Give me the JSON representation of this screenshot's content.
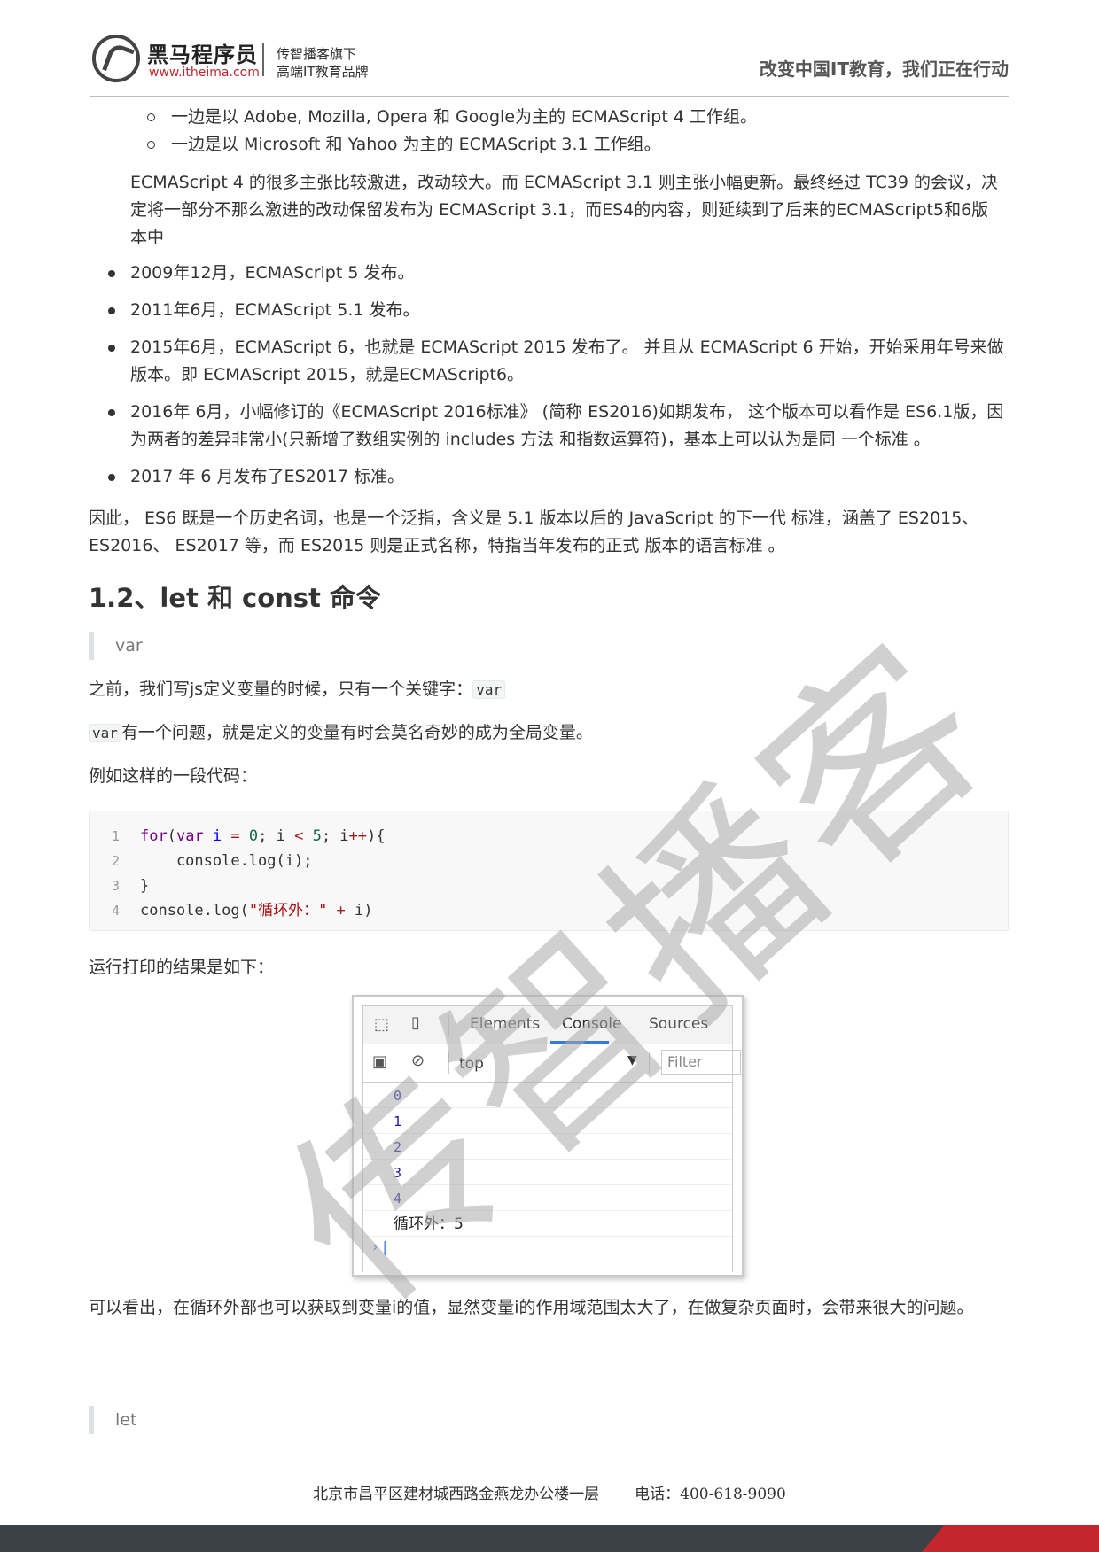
{
  "header": {
    "logo_name": "黑马程序员",
    "logo_url": "www.itheima.com",
    "logo_tag1": "传智播客旗下",
    "logo_tag2": "高端IT教育品牌",
    "slogan": "改变中国IT教育，我们正在行动"
  },
  "sub_list": [
    "一边是以 Adobe, Mozilla, Opera 和 Google为主的 ECMAScript 4 工作组。",
    "一边是以 Microsoft 和 Yahoo 为主的 ECMAScript 3.1 工作组。"
  ],
  "indent_paragraph": "ECMAScript 4 的很多主张比较激进，改动较大。而 ECMAScript 3.1 则主张小幅更新。最终经过 TC39 的会议，决定将一部分不那么激进的改动保留发布为 ECMAScript 3.1，而ES4的内容，则延续到了后来的ECMAScript5和6版本中",
  "bullets": [
    "2009年12月，ECMAScript 5 发布。",
    "2011年6月，ECMAScript 5.1 发布。",
    "2015年6月，ECMAScript 6，也就是 ECMAScript 2015 发布了。 并且从 ECMAScript 6 开始，开始采用年号来做版本。即 ECMAScript 2015，就是ECMAScript6。",
    "2016年 6月，小幅修订的《ECMAScript 2016标准》 (简称 ES2016)如期发布， 这个版本可以看作是 ES6.1版，因为两者的差异非常小(只新增了数组实例的 includes 方法 和指数运算符)，基本上可以认为是同 一个标准 。",
    "2017 年 6 月发布了ES2017 标准。"
  ],
  "summary": "因此， ES6 既是一个历史名词，也是一个泛指，含义是 5.1 版本以后的 JavaScript 的下一代 标准，涵盖了 ES2015、ES2016、 ES2017 等，而 ES2015 则是正式名称，特指当年发布的正式 版本的语言标准 。",
  "section_title": "1.2、let 和 const 命令",
  "quote_var": "var",
  "p_before": "之前，我们写js定义变量的时候，只有一个关键字：",
  "p_before_code": "var",
  "p_problem_code": "var",
  "p_problem": "有一个问题，就是定义的变量有时会莫名奇妙的成为全局变量。",
  "p_example": "例如这样的一段代码：",
  "code": {
    "line_numbers": [
      "1",
      "2",
      "3",
      "4"
    ],
    "l1_for": "for",
    "l1_open": "(",
    "l1_var": "var",
    "l1_i": " i ",
    "l1_eq": "=",
    "l1_zero": " 0",
    "l1_mid": "; i ",
    "l1_lt": "<",
    "l1_five": " 5",
    "l1_i2": "; i",
    "l1_pp": "++",
    "l1_end": "){",
    "l2": "    console.log(i);",
    "l3": "}",
    "l4_a": "console.log(",
    "l4_str": "\"循环外：\"",
    "l4_plus": " + ",
    "l4_b": "i)"
  },
  "p_result": "运行打印的结果是如下：",
  "devtools": {
    "tabs": [
      "Elements",
      "Console",
      "Sources"
    ],
    "active_tab": "Console",
    "context": "top",
    "filter_placeholder": "Filter",
    "output": [
      "0",
      "1",
      "2",
      "3",
      "4"
    ],
    "output_text": "循环外：5",
    "prompt": "› |"
  },
  "p_conclusion": "可以看出，在循环外部也可以获取到变量i的值，显然变量i的作用域范围太大了，在做复杂页面时，会带来很大的问题。",
  "quote_let": "let",
  "watermark": "传智播客",
  "footer": {
    "address": "北京市昌平区建材城西路金燕龙办公楼一层",
    "phone": "电话：400-618-9090"
  }
}
